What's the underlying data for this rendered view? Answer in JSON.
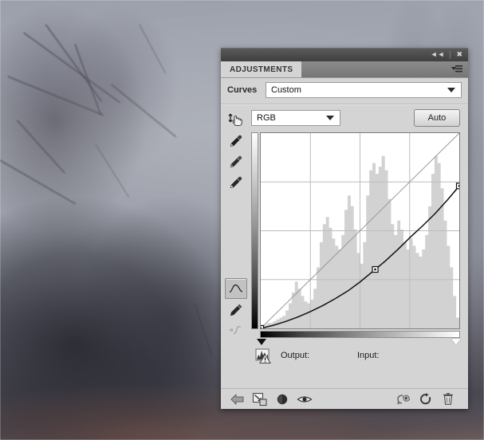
{
  "window": {
    "title_tab": "ADJUSTMENTS",
    "collapse_icon": "collapse-double-arrow-icon",
    "close_icon": "close-icon",
    "menu_icon": "panel-menu-icon"
  },
  "preset": {
    "label": "Curves",
    "value": "Custom",
    "dropdown_icon": "chevron-down-icon"
  },
  "channel": {
    "value": "RGB",
    "dropdown_icon": "chevron-down-icon",
    "auto_label": "Auto"
  },
  "tools": [
    {
      "name": "targeted-adjustment-tool",
      "icon": "hand-pointer-arrows-icon",
      "state": "normal"
    },
    {
      "name": "black-point-eyedropper",
      "icon": "eyedropper-black-icon",
      "state": "normal"
    },
    {
      "name": "gray-point-eyedropper",
      "icon": "eyedropper-gray-icon",
      "state": "normal"
    },
    {
      "name": "white-point-eyedropper",
      "icon": "eyedropper-white-icon",
      "state": "normal"
    },
    {
      "name": "curve-edit-tool",
      "icon": "curve-icon",
      "state": "selected"
    },
    {
      "name": "pencil-draw-tool",
      "icon": "pencil-icon",
      "state": "normal"
    },
    {
      "name": "smooth-curve-tool",
      "icon": "smooth-curve-icon",
      "state": "disabled"
    }
  ],
  "readout": {
    "warning_icon": "histogram-warning-icon",
    "output_label": "Output:",
    "output_value": "",
    "input_label": "Input:",
    "input_value": ""
  },
  "bottom_bar": {
    "left": [
      {
        "name": "return-to-adjustment-list-button",
        "icon": "back-arrow-icon"
      },
      {
        "name": "clip-to-layer-button",
        "icon": "clip-to-layer-icon"
      },
      {
        "name": "toggle-layer-visibility-button",
        "icon": "preview-half-circle-icon"
      },
      {
        "name": "preview-eye-button",
        "icon": "eye-icon"
      }
    ],
    "right": [
      {
        "name": "view-previous-state-button",
        "icon": "mask-view-icon"
      },
      {
        "name": "reset-adjustment-button",
        "icon": "reset-circular-arrow-icon"
      },
      {
        "name": "delete-adjustment-layer-button",
        "icon": "trash-icon"
      }
    ]
  },
  "colors": {
    "panel_bg": "#d4d4d4",
    "titlebar": "#4a4a4a",
    "tabstrip": "#808080",
    "plot_bg": "#ffffff",
    "grid_line": "#bdbdbd",
    "histogram": "#d2d2d2",
    "baseline": "#9a9a9a",
    "curve": "#101010"
  },
  "chart_data": {
    "type": "line",
    "title": "Curves (RGB)",
    "xlabel": "Input",
    "ylabel": "Output",
    "xlim": [
      0,
      255
    ],
    "ylim": [
      0,
      255
    ],
    "grid": true,
    "grid_divisions": 4,
    "legend": "none",
    "series": [
      {
        "name": "baseline-identity",
        "style": "gray diagonal reference line",
        "x": [
          0,
          255
        ],
        "y": [
          0,
          255
        ]
      },
      {
        "name": "rgb-curve",
        "style": "black editable curve",
        "control_points": [
          {
            "input": 0,
            "output": 0
          },
          {
            "input": 147,
            "output": 77
          },
          {
            "input": 255,
            "output": 186
          }
        ],
        "x": [
          0,
          16,
          32,
          48,
          64,
          80,
          96,
          112,
          128,
          147,
          160,
          176,
          192,
          208,
          224,
          240,
          255
        ],
        "y": [
          0,
          4,
          9,
          15,
          22,
          30,
          39,
          49,
          61,
          77,
          88,
          103,
          119,
          134,
          150,
          168,
          186
        ]
      }
    ],
    "histogram": {
      "name": "image-histogram",
      "bins": 64,
      "values": [
        2,
        2,
        3,
        3,
        4,
        5,
        6,
        7,
        10,
        14,
        20,
        26,
        22,
        18,
        15,
        14,
        16,
        22,
        34,
        48,
        58,
        62,
        56,
        50,
        46,
        44,
        52,
        66,
        74,
        68,
        55,
        42,
        36,
        48,
        74,
        88,
        92,
        86,
        90,
        96,
        88,
        72,
        58,
        52,
        60,
        55,
        48,
        44,
        50,
        46,
        42,
        40,
        44,
        52,
        68,
        86,
        96,
        92,
        78,
        60,
        46,
        34,
        18,
        6
      ],
      "max": 100
    },
    "gradient_bars": {
      "vertical": "white-to-black top-to-bottom (output)",
      "horizontal": "black-to-white left-to-right (input)"
    },
    "sliders": [
      {
        "name": "black-point-slider",
        "position": 0,
        "fill": "black"
      },
      {
        "name": "white-point-slider",
        "position": 255,
        "fill": "white"
      }
    ]
  }
}
